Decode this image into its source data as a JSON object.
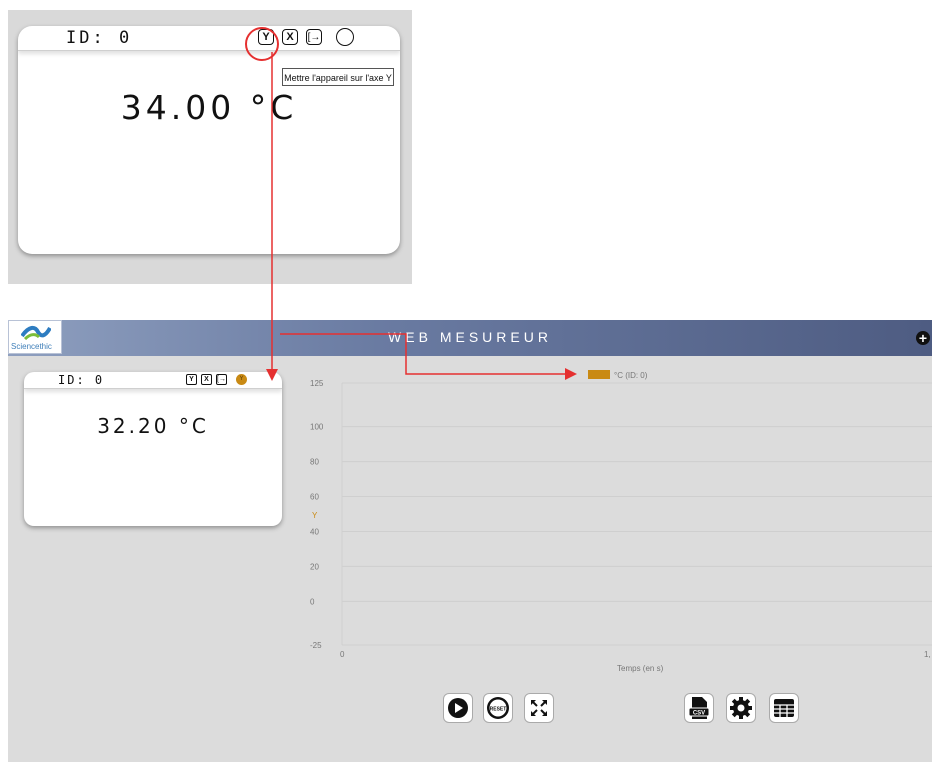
{
  "zoom": {
    "id_label": "ID: 0",
    "value": "34.00 °C",
    "tooltip": "Mettre l'appareil sur l'axe Y",
    "btn_y": "Y",
    "btn_x": "X",
    "btn_exit": "[→"
  },
  "header": {
    "logo_text": "Sciencethic",
    "title": "WEB MESUREUR",
    "add_icon": "plus-circle"
  },
  "device": {
    "id_label": "ID: 0",
    "value": "32.20 °C",
    "btn_y": "Y",
    "btn_x": "X",
    "btn_exit": "[→",
    "axis_badge": "Y",
    "axis_color": "#c98a14"
  },
  "chart_data": {
    "type": "line",
    "legend": [
      {
        "name": "°C (ID: 0)",
        "color": "#c98a14"
      }
    ],
    "y_ticks": [
      "125",
      "100",
      "80",
      "60",
      "40",
      "20",
      "0",
      "-25"
    ],
    "x_ticks": [
      "0",
      "1,"
    ],
    "xlabel": "Temps (en s)",
    "ylabel_icon": "Y",
    "ylim": [
      -25,
      125
    ],
    "xlim": [
      0,
      1
    ],
    "grid": true,
    "legend_position": "top",
    "series": []
  },
  "toolbar": {
    "play": "play-icon",
    "reset": "RESET",
    "expand": "expand-icon",
    "csv": "CSV",
    "settings": "gear-icon",
    "table": "table-icon"
  },
  "annotation_color": "#e53030"
}
